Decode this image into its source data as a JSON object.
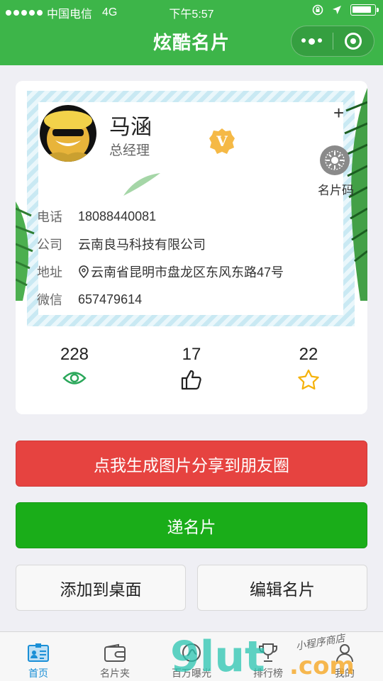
{
  "status_bar": {
    "carrier": "中国电信",
    "network": "4G",
    "time": "下午5:57"
  },
  "nav": {
    "title": "炫酷名片"
  },
  "card": {
    "name": "马涵",
    "title": "总经理",
    "badge": "V",
    "qr_label": "名片码",
    "fields": [
      {
        "key": "电话",
        "value": "18088440081"
      },
      {
        "key": "公司",
        "value": "云南良马科技有限公司"
      },
      {
        "key": "地址",
        "value": "云南省昆明市盘龙区东风东路47号"
      },
      {
        "key": "微信",
        "value": "657479614"
      }
    ],
    "stats": [
      {
        "value": "228",
        "icon": "eye-icon"
      },
      {
        "value": "17",
        "icon": "thumbs-up-icon"
      },
      {
        "value": "22",
        "icon": "star-icon"
      }
    ]
  },
  "actions": {
    "share": "点我生成图片分享到朋友圈",
    "send": "递名片",
    "add_desktop": "添加到桌面",
    "edit": "编辑名片"
  },
  "tabs": [
    {
      "label": "首页",
      "icon": "card-icon",
      "active": true
    },
    {
      "label": "名片夹",
      "icon": "wallet-icon",
      "active": false
    },
    {
      "label": "百万曝光",
      "icon": "exposure-icon",
      "active": false
    },
    {
      "label": "排行榜",
      "icon": "trophy-icon",
      "active": false
    },
    {
      "label": "我的",
      "icon": "user-icon",
      "active": false
    }
  ],
  "watermark": {
    "brand": "9lut",
    "suffix": ".com",
    "tagline": "小程序商店"
  },
  "colors": {
    "brand_green": "#3db549",
    "share_red": "#e64340",
    "send_green": "#1aad19",
    "active_tab": "#1a8fd6",
    "badge_gold": "#f5b946"
  }
}
